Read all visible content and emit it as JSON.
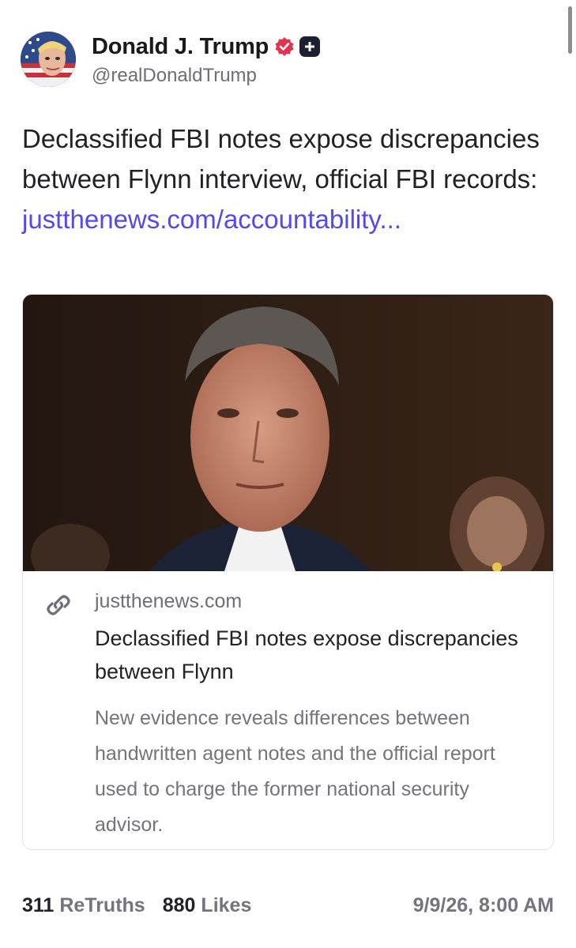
{
  "author": {
    "display_name": "Donald J. Trump",
    "handle": "@realDonaldTrump",
    "verified_icon": "verified-badge-icon",
    "plus_icon": "plus-badge-icon"
  },
  "post": {
    "text": "Declassified FBI notes expose discrepancies between Flynn interview, official FBI records:",
    "link_text": "justthenews.com/accountability..."
  },
  "card": {
    "domain": "justthenews.com",
    "title": "Declassified FBI notes expose discrepancies between Flynn",
    "description": "New evidence reveals differences between handwritten agent notes and the official report used to charge the former national security advisor."
  },
  "stats": {
    "retruths_count": "311",
    "retruths_label": "ReTruths",
    "likes_count": "880",
    "likes_label": "Likes",
    "timestamp": "9/9/26, 8:00 AM"
  },
  "colors": {
    "link": "#5448ee",
    "verified": "#e2334f",
    "muted": "#74747e"
  }
}
